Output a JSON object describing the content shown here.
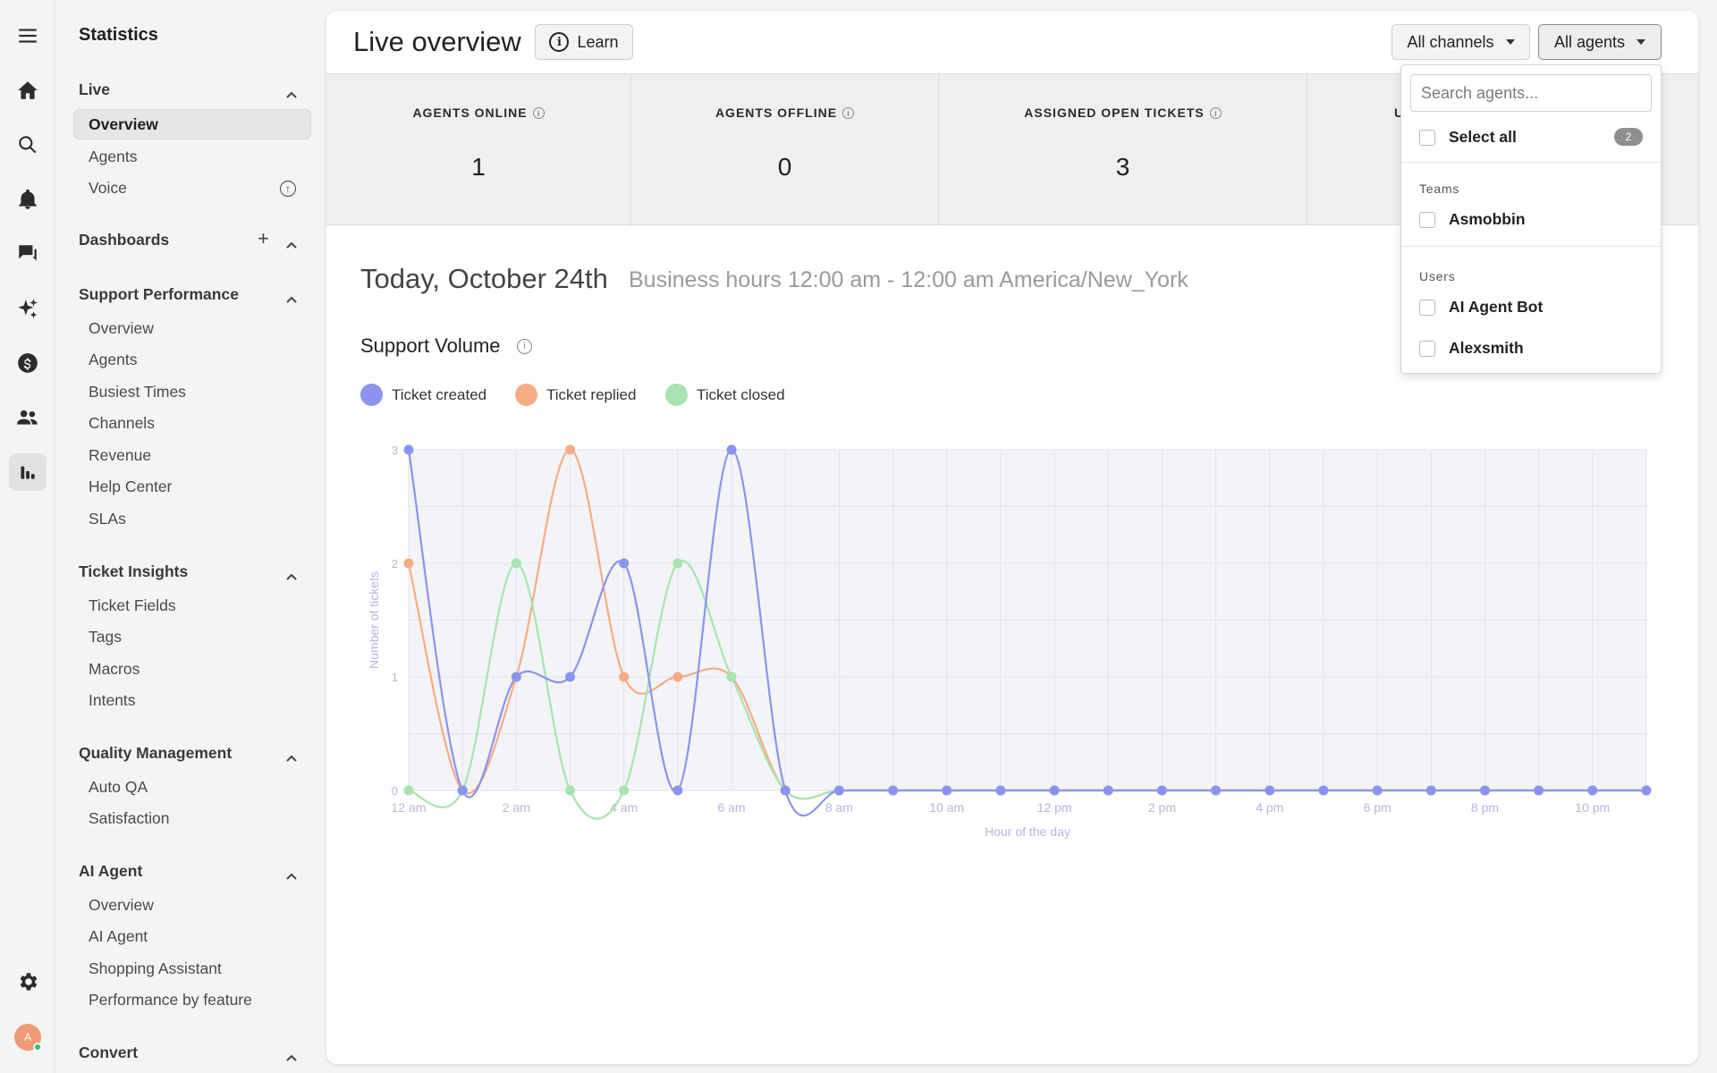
{
  "sidebar": {
    "title": "Statistics",
    "sections": {
      "live": {
        "label": "Live",
        "items": [
          "Overview",
          "Agents",
          "Voice"
        ]
      },
      "dashboards": {
        "label": "Dashboards"
      },
      "support_performance": {
        "label": "Support Performance",
        "items": [
          "Overview",
          "Agents",
          "Busiest Times",
          "Channels",
          "Revenue",
          "Help Center",
          "SLAs"
        ]
      },
      "ticket_insights": {
        "label": "Ticket Insights",
        "items": [
          "Ticket Fields",
          "Tags",
          "Macros",
          "Intents"
        ]
      },
      "quality_management": {
        "label": "Quality Management",
        "items": [
          "Auto QA",
          "Satisfaction"
        ]
      },
      "ai_agent": {
        "label": "AI Agent",
        "items": [
          "Overview",
          "AI Agent",
          "Shopping Assistant",
          "Performance by feature"
        ]
      },
      "convert": {
        "label": "Convert"
      }
    }
  },
  "rail": {
    "icons": [
      "menu-icon",
      "home-icon",
      "search-icon",
      "bell-icon",
      "chat-icon",
      "sparkle-icon",
      "dollar-icon",
      "users-icon",
      "chart-icon",
      "gear-icon"
    ],
    "avatar_initial": "A"
  },
  "header": {
    "title": "Live overview",
    "learn_label": "Learn",
    "channels_label": "All channels",
    "agents_label": "All agents"
  },
  "kpis": [
    {
      "label": "AGENTS ONLINE",
      "value": "1"
    },
    {
      "label": "AGENTS OFFLINE",
      "value": "0"
    },
    {
      "label": "ASSIGNED OPEN TICKETS",
      "value": "3"
    },
    {
      "label": "U",
      "value": ""
    }
  ],
  "date": {
    "title": "Today, October 24th",
    "business_hours": "Business hours 12:00 am - 12:00 am America/New_York"
  },
  "volume": {
    "title": "Support Volume",
    "legend": [
      {
        "label": "Ticket created",
        "color": "#8b93ee"
      },
      {
        "label": "Ticket replied",
        "color": "#f7ab84"
      },
      {
        "label": "Ticket closed",
        "color": "#a8e3b0"
      }
    ]
  },
  "dropdown": {
    "search_placeholder": "Search agents...",
    "select_all": "Select all",
    "count": "2",
    "teams_label": "Teams",
    "teams": [
      "Asmobbin"
    ],
    "users_label": "Users",
    "users": [
      "AI Agent Bot",
      "Alexsmith"
    ]
  },
  "chart_data": {
    "type": "line",
    "xlabel": "Hour of the day",
    "ylabel": "Number of tickets",
    "ylim": [
      0,
      3
    ],
    "yticks": [
      "0",
      "1",
      "2",
      "3"
    ],
    "x": [
      "12 am",
      "1 am",
      "2 am",
      "3 am",
      "4 am",
      "5 am",
      "6 am",
      "7 am",
      "8 am",
      "9 am",
      "10 am",
      "11 am",
      "12 pm",
      "1 pm",
      "2 pm",
      "3 pm",
      "4 pm",
      "5 pm",
      "6 pm",
      "7 pm",
      "8 pm",
      "9 pm",
      "10 pm",
      "11 pm"
    ],
    "xtick_labels": [
      "12 am",
      "",
      "2 am",
      "",
      "4 am",
      "",
      "6 am",
      "",
      "8 am",
      "",
      "10 am",
      "",
      "12 pm",
      "",
      "2 pm",
      "",
      "4 pm",
      "",
      "6 pm",
      "",
      "8 pm",
      "",
      "10 pm",
      ""
    ],
    "grid": true,
    "series": [
      {
        "name": "Ticket replied",
        "color": "#f7ab84",
        "values": [
          2,
          0,
          1,
          3,
          1,
          1,
          1,
          0,
          0,
          0,
          0,
          0,
          0,
          0,
          0,
          0,
          0,
          0,
          0,
          0,
          0,
          0,
          0,
          0
        ]
      },
      {
        "name": "Ticket closed",
        "color": "#a8e3b0",
        "values": [
          0,
          0,
          2,
          0,
          0,
          2,
          1,
          0,
          0,
          0,
          0,
          0,
          0,
          0,
          0,
          0,
          0,
          0,
          0,
          0,
          0,
          0,
          0,
          0
        ]
      },
      {
        "name": "Ticket created",
        "color": "#8b93ee",
        "values": [
          3,
          0,
          1,
          1,
          2,
          0,
          3,
          0,
          0,
          0,
          0,
          0,
          0,
          0,
          0,
          0,
          0,
          0,
          0,
          0,
          0,
          0,
          0,
          0
        ]
      }
    ]
  }
}
